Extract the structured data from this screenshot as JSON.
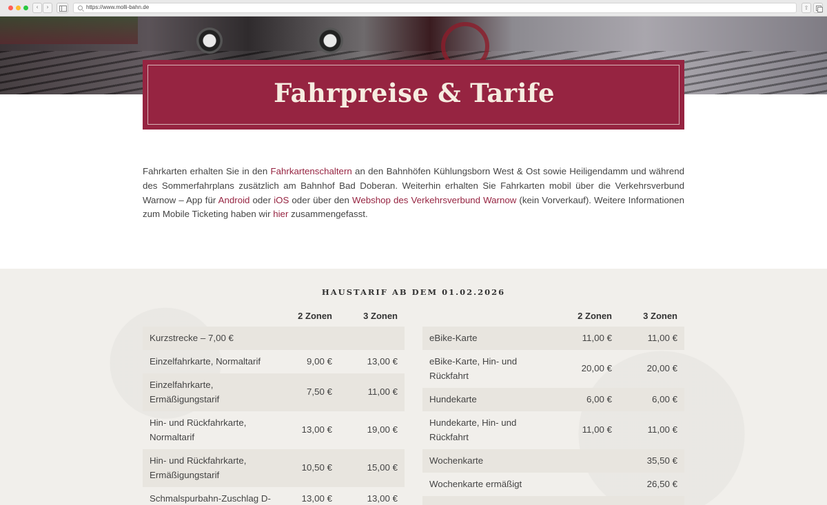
{
  "browser": {
    "url": "https://www.molli-bahn.de",
    "back_glyph": "‹",
    "forward_glyph": "›",
    "share_glyph": "⇧"
  },
  "header": {
    "title": "Fahrpreise & Tarife"
  },
  "intro": {
    "t1": "Fahrkarten erhalten Sie in den ",
    "link_schalter": "Fahrkartenschaltern",
    "t2": " an den Bahnhöfen Kühlungsborn West & Ost sowie Heiligendamm und während des Sommerfahrplans zusätzlich am Bahnhof Bad Doberan. Weiterhin erhalten Sie Fahrkarten mobil über die Verkehrsverbund Warnow – App für ",
    "link_android": "Android",
    "t3": " oder ",
    "link_ios": "iOS",
    "t4": " oder über den ",
    "link_webshop": "Webshop des Verkehrsverbund Warnow",
    "t5": " (kein Vorverkauf). Weitere Informationen zum Mobile Ticketing haben wir ",
    "link_hier": "hier",
    "t6": " zusammengefasst."
  },
  "tariff": {
    "heading": "HAUSTARIF AB DEM 01.02.2026",
    "left": {
      "col1": "2 Zonen",
      "col2": "3 Zonen",
      "rows": [
        {
          "name": "Kurzstrecke – 7,00 €",
          "v1": "",
          "v2": ""
        },
        {
          "name": "Einzelfahrkarte, Normaltarif",
          "v1": "9,00 €",
          "v2": "13,00 €"
        },
        {
          "name": "Einzelfahrkarte,\nErmäßigungstarif",
          "v1": "7,50 €",
          "v2": "11,00 €"
        },
        {
          "name": "Hin- und Rückfahrkarte,\nNormaltarif",
          "v1": "13,00 €",
          "v2": "19,00 €"
        },
        {
          "name": "Hin- und Rückfahrkarte,\nErmäßigungstarif",
          "v1": "10,50 €",
          "v2": "15,00 €"
        },
        {
          "name": "Schmalspurbahn-Zuschlag D-",
          "v1": "13,00 €",
          "v2": "13,00 €"
        }
      ]
    },
    "right": {
      "col1": "2 Zonen",
      "col2": "3 Zonen",
      "rows": [
        {
          "name": "eBike-Karte",
          "v1": "11,00 €",
          "v2": "11,00 €"
        },
        {
          "name": "eBike-Karte, Hin- und\nRückfahrt",
          "v1": "20,00 €",
          "v2": "20,00 €"
        },
        {
          "name": "Hundekarte",
          "v1": "6,00 €",
          "v2": "6,00 €"
        },
        {
          "name": "Hundekarte, Hin- und\nRückfahrt",
          "v1": "11,00 €",
          "v2": "11,00 €"
        },
        {
          "name": "Wochenkarte",
          "v1": "",
          "v2": "35,50 €"
        },
        {
          "name": "Wochenkarte ermäßigt",
          "v1": "",
          "v2": "26,50 €"
        },
        {
          "name": "",
          "v1": "",
          "v2": ""
        }
      ]
    }
  }
}
